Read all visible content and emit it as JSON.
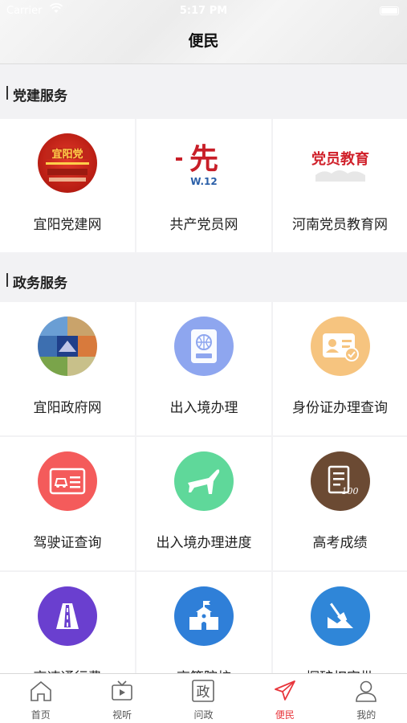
{
  "status_bar": {
    "carrier": "Carrier",
    "time": "5:17 PM"
  },
  "header": {
    "title": "便民"
  },
  "sections": [
    {
      "title": "党建服务",
      "items": [
        {
          "label": "宜阳党建网",
          "icon": "yiyang-party-logo"
        },
        {
          "label": "共产党员网",
          "icon": "party-member-logo",
          "logo_text": "先",
          "logo_sub": "W.12"
        },
        {
          "label": "河南党员教育网",
          "icon": "henan-education-logo",
          "logo_text": "党员教育"
        }
      ]
    },
    {
      "title": "政务服务",
      "items": [
        {
          "label": "宜阳政府网",
          "icon": "government-photo-icon",
          "color": "#5a8fc8"
        },
        {
          "label": "出入境办理",
          "icon": "passport-icon",
          "color": "#8ea6ef"
        },
        {
          "label": "身份证办理查询",
          "icon": "id-card-icon",
          "color": "#f6c47f"
        },
        {
          "label": "驾驶证查询",
          "icon": "driver-license-icon",
          "color": "#f45b5b"
        },
        {
          "label": "出入境办理进度",
          "icon": "airplane-icon",
          "color": "#5fd89a"
        },
        {
          "label": "高考成绩",
          "icon": "exam-score-icon",
          "color": "#6b4a33"
        },
        {
          "label": "高速通行费",
          "icon": "highway-icon",
          "color": "#6a3fcf"
        },
        {
          "label": "高等院校",
          "icon": "school-icon",
          "color": "#2f7fd8"
        },
        {
          "label": "探矿权审批",
          "icon": "mining-shovel-icon",
          "color": "#2f86d8"
        }
      ]
    }
  ],
  "tabbar": {
    "items": [
      {
        "label": "首页",
        "icon": "home-icon",
        "active": false
      },
      {
        "label": "视听",
        "icon": "tv-icon",
        "active": false
      },
      {
        "label": "问政",
        "icon": "politics-icon",
        "glyph": "政",
        "active": false
      },
      {
        "label": "便民",
        "icon": "paper-plane-icon",
        "active": true
      },
      {
        "label": "我的",
        "icon": "user-icon",
        "active": false
      }
    ]
  }
}
